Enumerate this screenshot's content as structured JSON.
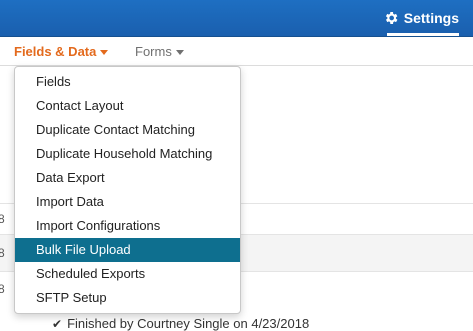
{
  "header": {
    "settings_label": "Settings",
    "settings_icon": "gear-icon"
  },
  "nav": {
    "tabs": [
      {
        "label": "Fields & Data",
        "active": true
      },
      {
        "label": "Forms",
        "active": false
      }
    ]
  },
  "dropdown": {
    "items": [
      {
        "label": "Fields"
      },
      {
        "label": "Contact Layout"
      },
      {
        "label": "Duplicate Contact Matching"
      },
      {
        "label": "Duplicate Household Matching"
      },
      {
        "label": "Data Export"
      },
      {
        "label": "Import Data"
      },
      {
        "label": "Import Configurations"
      },
      {
        "label": "Bulk File Upload",
        "highlighted": true
      },
      {
        "label": "Scheduled Exports"
      },
      {
        "label": "SFTP Setup"
      }
    ]
  },
  "background": {
    "row_digits": [
      "8",
      "8",
      "8"
    ],
    "footer_status": "Finished by Courtney Single on 4/23/2018"
  },
  "colors": {
    "topbar": "#1a64b4",
    "active_tab": "#e36a1d",
    "highlight": "#0e6f8f"
  }
}
